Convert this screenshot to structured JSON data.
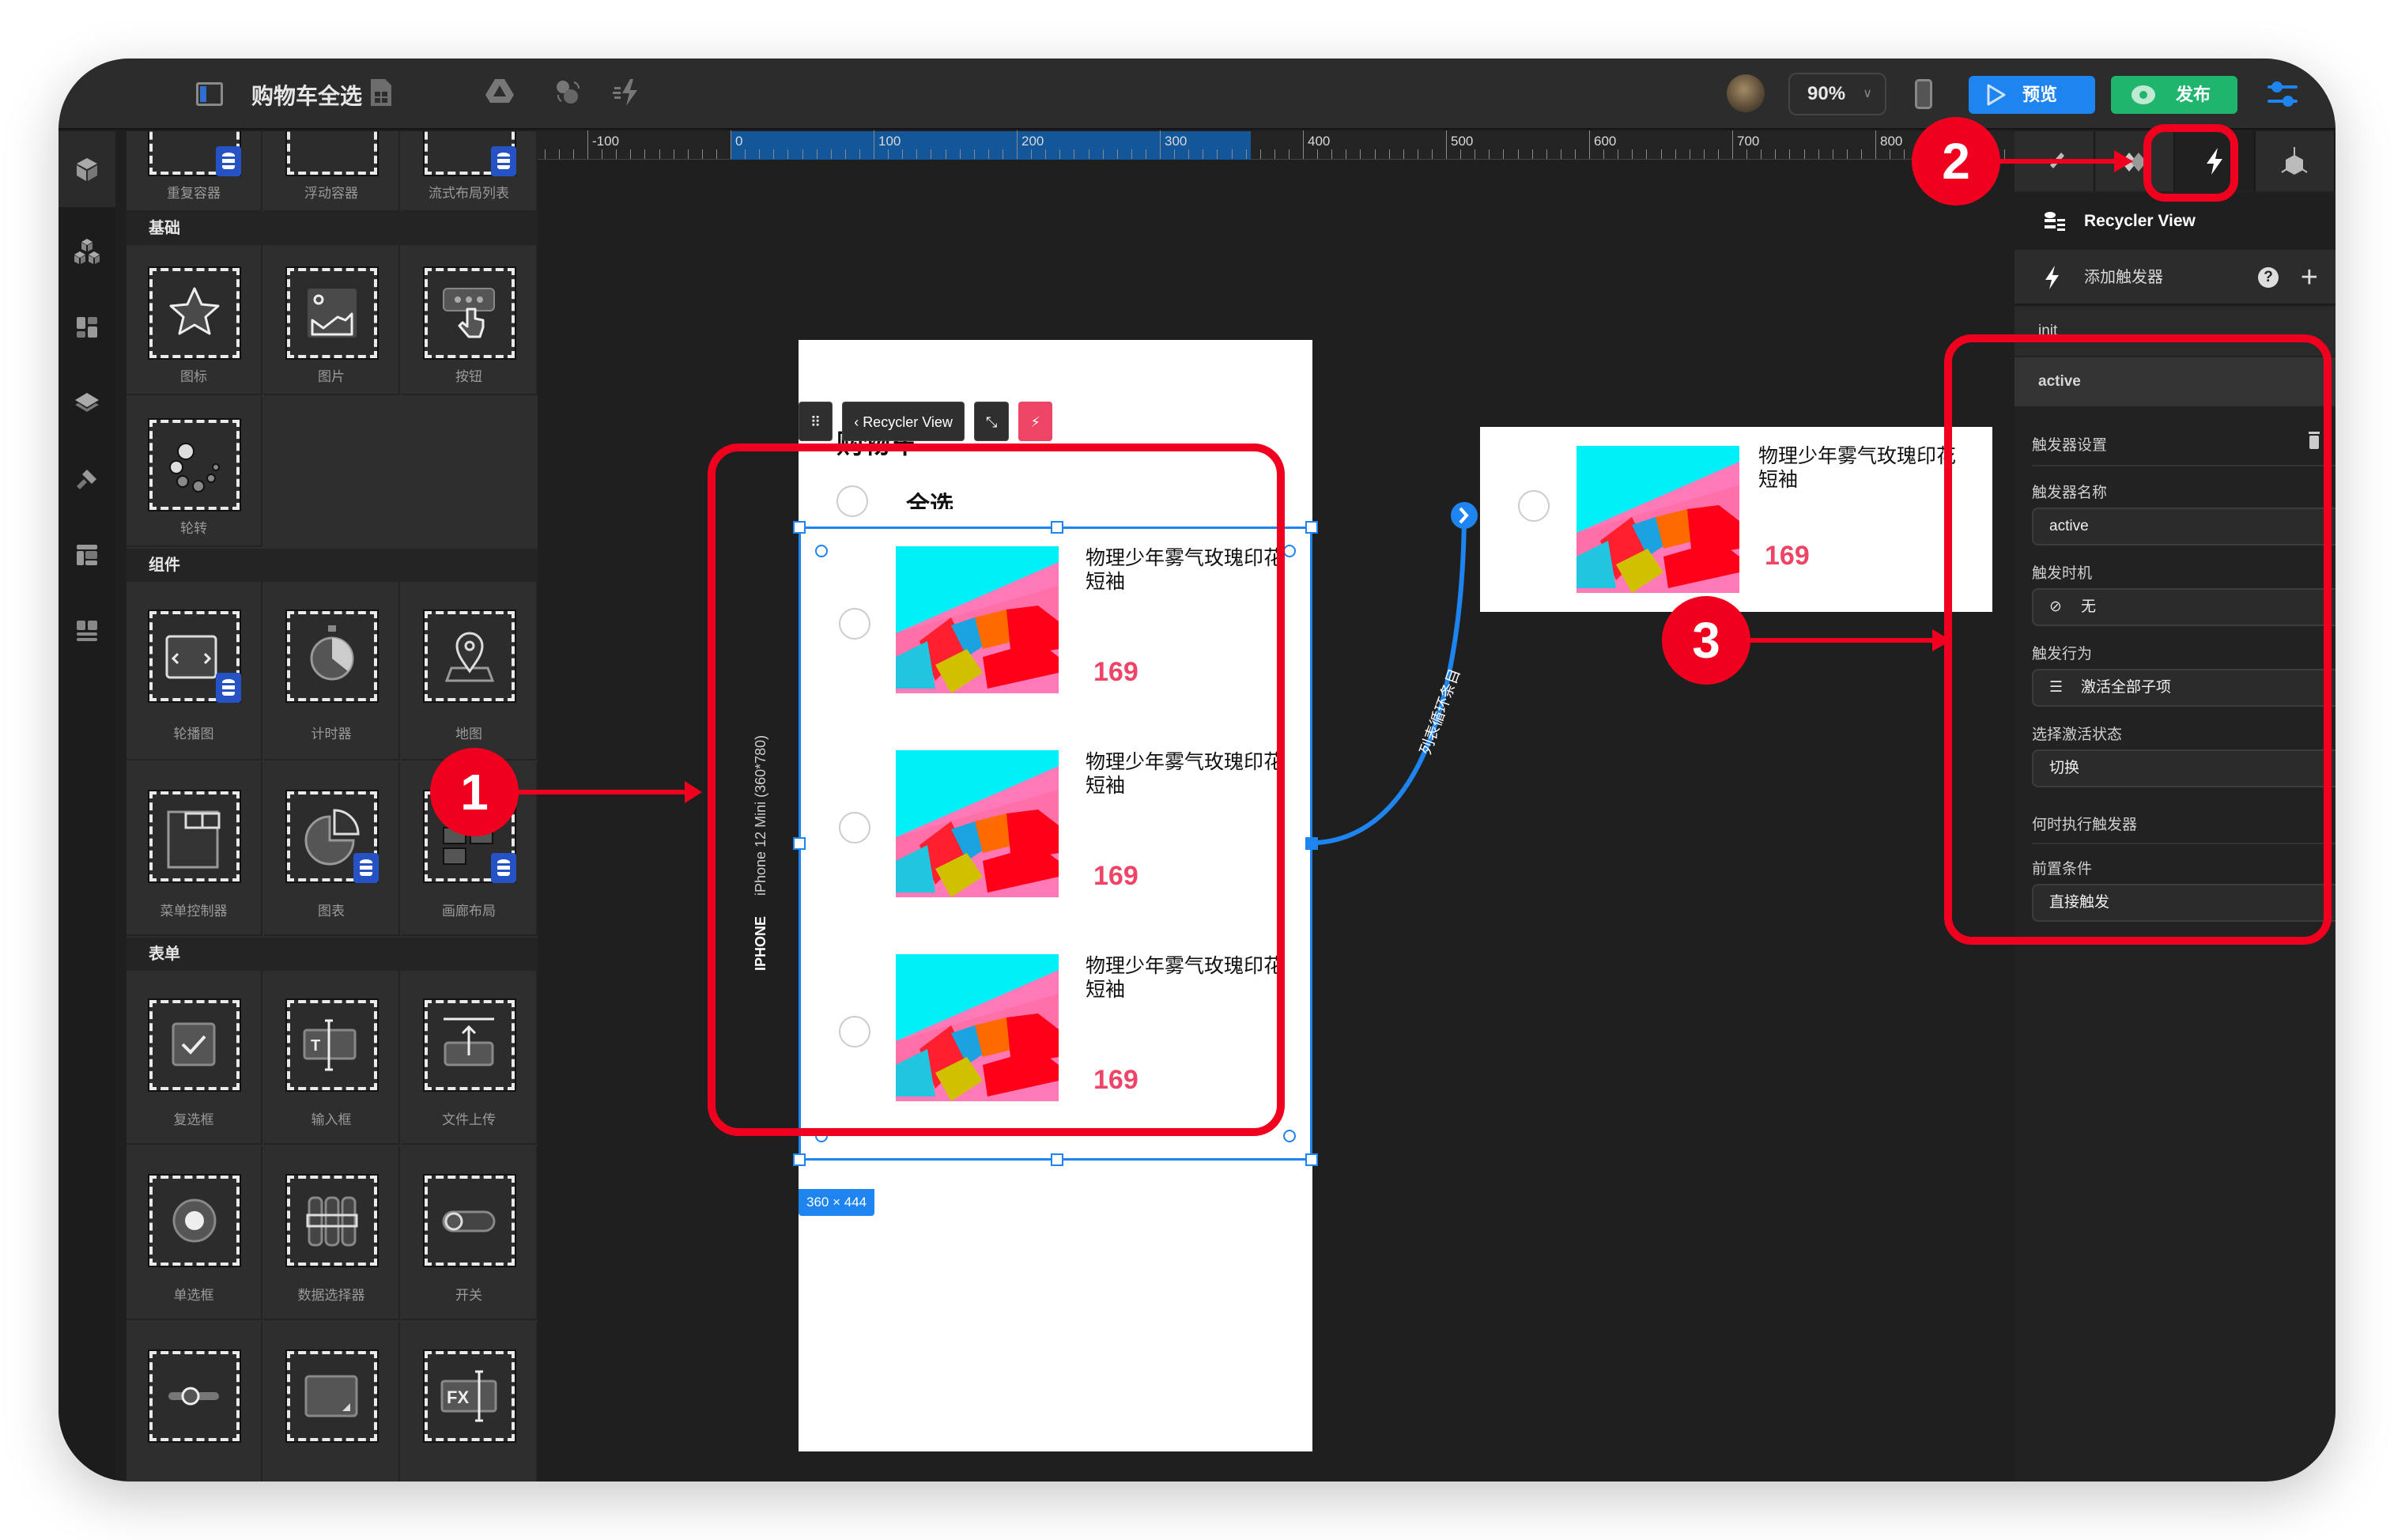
{
  "app": {
    "project_title": "购物车全选",
    "zoom_level": "90%",
    "preview_label": "预览",
    "publish_label": "发布"
  },
  "toolbar_icons": [
    "sheet-icon",
    "drive-icon",
    "swap-icon",
    "fast-trigger-icon"
  ],
  "rail_icons": [
    "cube-icon",
    "cubes-icon",
    "dashboard-icon",
    "layers-icon",
    "paint-roller-icon",
    "template-icon",
    "layout-icon"
  ],
  "components_panel": {
    "top_row": [
      "重复容器",
      "浮动容器",
      "流式布局列表"
    ],
    "sections": [
      {
        "title": "基础",
        "items": [
          "图标",
          "图片",
          "按钮",
          "轮转"
        ]
      },
      {
        "title": "组件",
        "items": [
          "轮播图",
          "计时器",
          "地图",
          "菜单控制器",
          "图表",
          "画廊布局"
        ]
      },
      {
        "title": "表单",
        "items": [
          "复选框",
          "输入框",
          "文件上传",
          "单选框",
          "数据选择器",
          "开关",
          "滑块",
          "文本域",
          "公式输入"
        ]
      }
    ]
  },
  "ruler": {
    "labels": [
      "-100",
      "0",
      "100",
      "200",
      "300",
      "400",
      "500",
      "600",
      "700",
      "800"
    ]
  },
  "phone": {
    "device_brand": "IPHONE",
    "device_model": "iPhone 12 Mini (360*780)",
    "page_title": "购物车",
    "select_all_label": "全选",
    "selection_size": "360 × 444",
    "context_bar_label": "Recycler View"
  },
  "cart_items": [
    {
      "name": "物理少年雾气玫瑰印花短袖",
      "price": "169"
    },
    {
      "name": "物理少年雾气玫瑰印花短袖",
      "price": "169"
    },
    {
      "name": "物理少年雾气玫瑰印花短袖",
      "price": "169"
    }
  ],
  "preview_item": {
    "name": "物理少年雾气玫瑰印花短袖",
    "price": "169"
  },
  "connector_label": "列表循环条目",
  "annotations": [
    "1",
    "2",
    "3"
  ],
  "right_panel": {
    "tabs": [
      "style-tab",
      "interaction-tab",
      "trigger-tab",
      "component-tab"
    ],
    "active_tab": "trigger-tab",
    "component_name": "Recycler View",
    "add_trigger_label": "添加触发器",
    "triggers": [
      "init",
      "active"
    ],
    "trigger_settings_title": "触发器设置",
    "trigger_name_label": "触发器名称",
    "trigger_name_value": "active",
    "trigger_timing_label": "触发时机",
    "trigger_timing_value": "无",
    "trigger_action_label": "触发行为",
    "trigger_action_value": "激活全部子项",
    "activate_state_label": "选择激活状态",
    "activate_state_value": "切换",
    "when_execute_label": "何时执行触发器",
    "precondition_label": "前置条件",
    "precondition_value": "直接触发"
  },
  "colors": {
    "accent_blue": "#1e84f0",
    "publish_green": "#1fb56d",
    "price_red": "#ee4466",
    "annotation_red": "#f0001e"
  }
}
